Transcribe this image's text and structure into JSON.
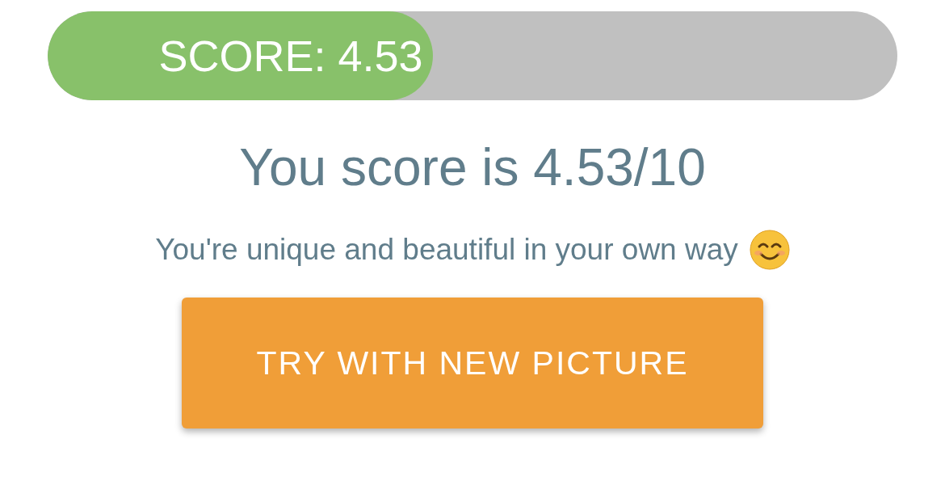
{
  "score_bar": {
    "label": "SCORE: 4.53",
    "level": 0.453
  },
  "result": "You score is 4.53/10",
  "message": "You're unique and beautiful in your own way",
  "button": "TRY WITH NEW PICTURE"
}
